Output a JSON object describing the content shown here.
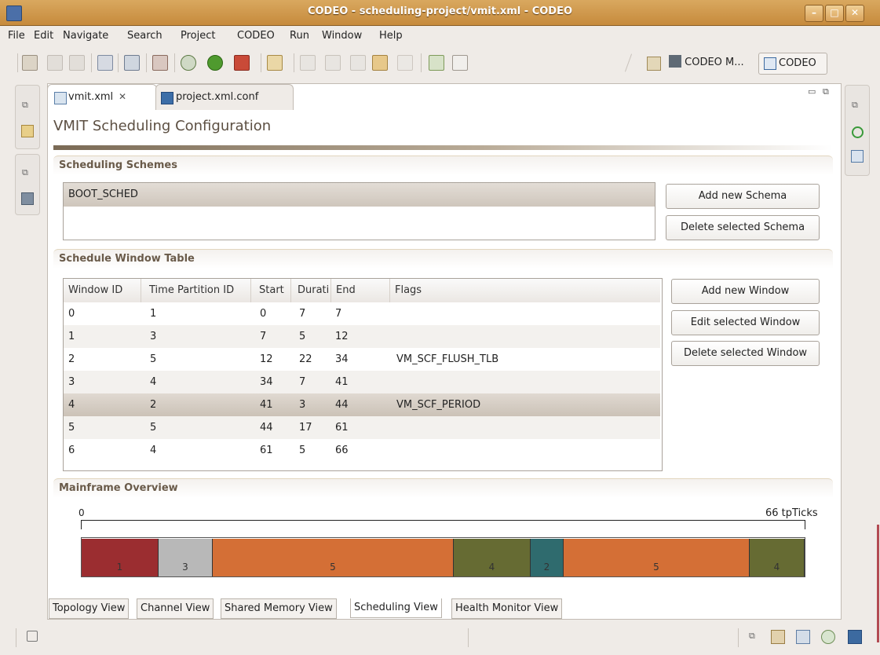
{
  "window": {
    "title": "CODEO - scheduling-project/vmit.xml - CODEO"
  },
  "menu": [
    "File",
    "Edit",
    "Navigate",
    "Search",
    "Project",
    "CODEO",
    "Run",
    "Window",
    "Help"
  ],
  "perspectives": {
    "first": "CODEO M...",
    "second": "CODEO"
  },
  "tabs": [
    "vmit.xml",
    "project.xml.conf"
  ],
  "page_title": "VMIT Scheduling Configuration",
  "schemes": {
    "heading": "Scheduling Schemes",
    "items": [
      "BOOT_SCHED"
    ],
    "add_label": "Add new Schema",
    "delete_label": "Delete selected Schema"
  },
  "window_table": {
    "heading": "Schedule Window Table",
    "columns": [
      "Window ID",
      "Time Partition ID",
      "Start",
      "Durati",
      "End",
      "Flags"
    ],
    "rows": [
      [
        "0",
        "1",
        "0",
        "7",
        "7",
        ""
      ],
      [
        "1",
        "3",
        "7",
        "5",
        "12",
        ""
      ],
      [
        "2",
        "5",
        "12",
        "22",
        "34",
        "VM_SCF_FLUSH_TLB"
      ],
      [
        "3",
        "4",
        "34",
        "7",
        "41",
        ""
      ],
      [
        "4",
        "2",
        "41",
        "3",
        "44",
        "VM_SCF_PERIOD"
      ],
      [
        "5",
        "5",
        "44",
        "17",
        "61",
        ""
      ],
      [
        "6",
        "4",
        "61",
        "5",
        "66",
        ""
      ]
    ],
    "selected_row": 4,
    "add_label": "Add new Window",
    "edit_label": "Edit selected Window",
    "delete_label": "Delete selected Window"
  },
  "mainframe": {
    "heading": "Mainframe Overview",
    "start_label": "0",
    "end_label": "66 tpTicks",
    "total": 66,
    "partition_colors": {
      "1": "#9b2d30",
      "2": "#2f6b6e",
      "3": "#b8b8b8",
      "4": "#666b33",
      "5": "#d46f36"
    }
  },
  "bottom_tabs": [
    "Topology View",
    "Channel View",
    "Shared Memory View",
    "Scheduling View",
    "Health Monitor View"
  ],
  "active_bottom_tab": "Scheduling View"
}
